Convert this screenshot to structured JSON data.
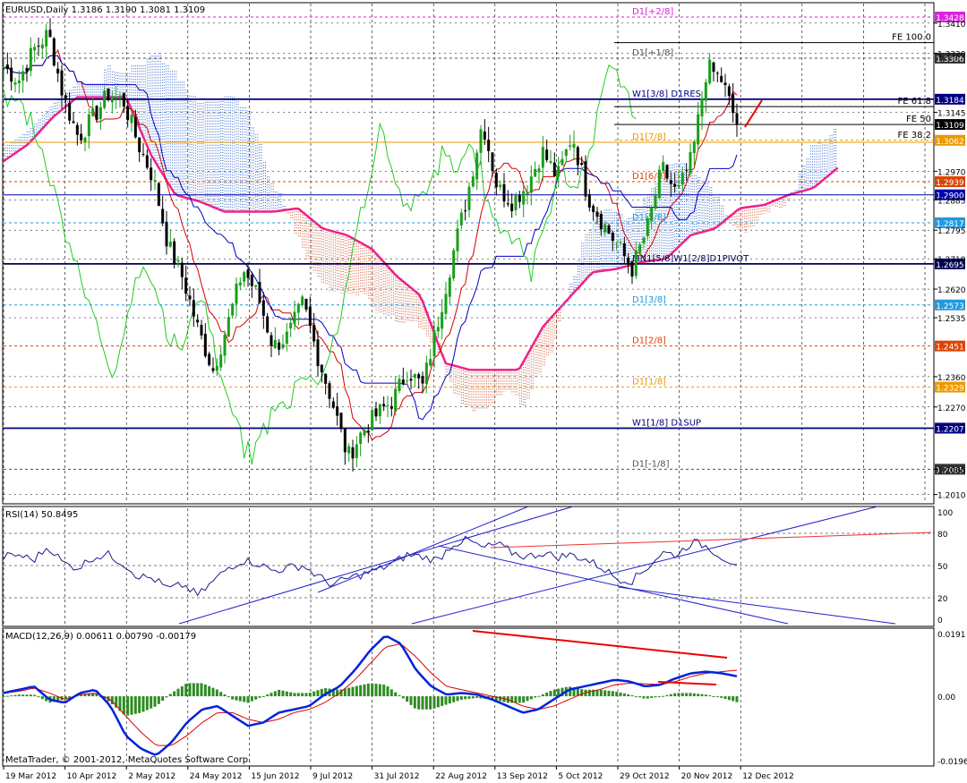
{
  "header": {
    "main_title": "EURUSD,Daily  1.3186 1.3190 1.3081 1.3109",
    "rsi_title": "RSI(14) 50.8495",
    "macd_title": "MACD(12,26,9) 0.00611 0.00790 -0.00179",
    "copyright": "MetaTrader, © 2001-2012, MetaQuotes Software Corp."
  },
  "colors": {
    "tenkan": "#d40000",
    "kijun": "#0000c0",
    "chikou": "#22cc22",
    "senkou_b": "#ee2288",
    "kumo_bull": "#3366cc",
    "kumo_bear": "#cc5533",
    "rsi": "#1a1a8c",
    "macd": "#0022dd",
    "signal": "#dd0000",
    "hist": "#2e8b22",
    "bull_candle": "#1a9e1a",
    "bear_candle": "#000000"
  },
  "chart_data": [
    {
      "type": "line",
      "title": "EURUSD,Daily  1.3186 1.3190 1.3081 1.3109",
      "x_tick_labels": [
        "19 Mar 2012",
        "10 Apr 2012",
        "2 May 2012",
        "24 May 2012",
        "15 Jun 2012",
        "9 Jul 2012",
        "31 Jul 2012",
        "22 Aug 2012",
        "13 Sep 2012",
        "5 Oct 2012",
        "29 Oct 2012",
        "20 Nov 2012",
        "12 Dec 2012"
      ],
      "y_ticks": [
        "1.3410",
        "1.3320",
        "1.3145",
        "1.2970",
        "1.2885",
        "1.2795",
        "1.2710",
        "1.2620",
        "1.2535",
        "1.2360",
        "1.2270",
        "1.2085",
        "1.2010"
      ],
      "ylim": [
        1.1985,
        1.3468
      ],
      "close_anchors": [
        1.328,
        1.324,
        1.333,
        1.338,
        1.319,
        1.307,
        1.313,
        1.32,
        1.318,
        1.305,
        1.295,
        1.275,
        1.265,
        1.25,
        1.238,
        1.252,
        1.268,
        1.26,
        1.245,
        1.248,
        1.258,
        1.242,
        1.228,
        1.212,
        1.22,
        1.225,
        1.229,
        1.238,
        1.233,
        1.252,
        1.272,
        1.29,
        1.312,
        1.292,
        1.288,
        1.293,
        1.303,
        1.295,
        1.308,
        1.29,
        1.282,
        1.275,
        1.268,
        1.28,
        1.298,
        1.29,
        1.301,
        1.328,
        1.324,
        1.3109
      ],
      "senkou_b_anchors": [
        1.3,
        1.305,
        1.313,
        1.319,
        1.319,
        1.319,
        1.302,
        1.29,
        1.288,
        1.285,
        1.285,
        1.285,
        1.286,
        1.28,
        1.278,
        1.274,
        1.266,
        1.26,
        1.24,
        1.238,
        1.238,
        1.238,
        1.251,
        1.259,
        1.267,
        1.268,
        1.27,
        1.271,
        1.278,
        1.28,
        1.286,
        1.287,
        1.29,
        1.292,
        1.298
      ],
      "levels": [
        {
          "label": "D1[+2/8]",
          "badge": "1.3428",
          "value": 1.3428,
          "color": "#dd22dd",
          "dash": "3,3",
          "badge_bg": "#dd22dd"
        },
        {
          "label": "FE 100.0",
          "badge": "",
          "value": 1.3352,
          "color": "#000000",
          "dash": "",
          "badge_bg": ""
        },
        {
          "label": "D1[+1/8]",
          "badge": "1.3306",
          "value": 1.3306,
          "color": "#555555",
          "dash": "3,3",
          "badge_bg": "#333333"
        },
        {
          "label": "W1[3/8] D1RES",
          "badge": "1.3184",
          "value": 1.3184,
          "color": "#000080",
          "dash": "",
          "badge_bg": "#000080"
        },
        {
          "label": "FE 61.8",
          "badge": "",
          "value": 1.3162,
          "color": "#000000",
          "dash": "",
          "badge_bg": ""
        },
        {
          "label": "FE 50",
          "badge": "1.3109",
          "value": 1.3109,
          "color": "#000000",
          "dash": "",
          "badge_bg": "#000000"
        },
        {
          "label": "FE 38.2",
          "badge": "1.3062",
          "value": 1.3062,
          "color": "#ee9900",
          "dash": "3,3",
          "badge_bg": "#ee9900"
        },
        {
          "label": "D1[7/8]",
          "badge": "",
          "value": 1.3056,
          "color": "#ee9900",
          "dash": "",
          "badge_bg": ""
        },
        {
          "label": "D1[6/8]",
          "badge": "1.2939",
          "value": 1.2939,
          "color": "#dd4400",
          "dash": "3,3",
          "badge_bg": "#dd4400"
        },
        {
          "label": "",
          "badge": "1.2900",
          "value": 1.29,
          "color": "#0000aa",
          "dash": "",
          "badge_bg": "#0000aa"
        },
        {
          "label": "D1[5/8]",
          "badge": "1.2817",
          "value": 1.2817,
          "color": "#2299dd",
          "dash": "3,3",
          "badge_bg": "#2299dd"
        },
        {
          "label": "MN1[5/8]W1[2/8]D1PIVOT",
          "badge": "1.2695",
          "value": 1.2695,
          "color": "#000055",
          "dash": "",
          "badge_bg": "#000055"
        },
        {
          "label": "D1[3/8]",
          "badge": "1.2573",
          "value": 1.2573,
          "color": "#2299dd",
          "dash": "3,3",
          "badge_bg": "#2299dd"
        },
        {
          "label": "D1[2/8]",
          "badge": "1.2451",
          "value": 1.2451,
          "color": "#dd4400",
          "dash": "3,3",
          "badge_bg": "#dd4400"
        },
        {
          "label": "D1[1/8]",
          "badge": "1.2329",
          "value": 1.2329,
          "color": "#ee9900",
          "dash": "3,3",
          "badge_bg": "#ee9900"
        },
        {
          "label": "W1[1/8] D1SUP",
          "badge": "1.2207",
          "value": 1.2207,
          "color": "#000080",
          "dash": "",
          "badge_bg": "#000080"
        },
        {
          "label": "D1[-1/8]",
          "badge": "1.2085",
          "value": 1.2085,
          "color": "#555555",
          "dash": "3,3",
          "badge_bg": "#333333"
        }
      ]
    },
    {
      "type": "line",
      "title": "RSI(14) 50.8495",
      "y_ticks": [
        "100",
        "80",
        "50",
        "20",
        "0"
      ],
      "ylim": [
        0,
        100
      ],
      "rsi_anchors": [
        58,
        60,
        55,
        68,
        52,
        48,
        58,
        60,
        52,
        40,
        38,
        28,
        32,
        22,
        35,
        48,
        55,
        52,
        45,
        48,
        50,
        40,
        32,
        38,
        42,
        46,
        52,
        60,
        58,
        55,
        70,
        74,
        66,
        70,
        62,
        58,
        62,
        58,
        60,
        55,
        48,
        38,
        36,
        48,
        62,
        60,
        72,
        68,
        58,
        51
      ]
    },
    {
      "type": "line",
      "title": "MACD(12,26,9) 0.00611 0.00790 -0.00179",
      "y_ticks": [
        "0.0191",
        "0.00",
        "-0.0196"
      ],
      "ylim": [
        -0.0196,
        0.0191
      ],
      "macd_anchors": [
        0.001,
        0.002,
        0.003,
        -0.001,
        -0.002,
        0.001,
        0.002,
        -0.003,
        -0.012,
        -0.016,
        -0.018,
        -0.014,
        -0.008,
        -0.004,
        -0.003,
        -0.006,
        -0.009,
        -0.008,
        -0.005,
        -0.004,
        -0.003,
        0.0005,
        0.003,
        0.008,
        0.014,
        0.0185,
        0.016,
        0.008,
        0.003,
        0.0005,
        0.001,
        0.0005,
        -0.001,
        -0.003,
        -0.005,
        -0.004,
        -0.001,
        0.002,
        0.003,
        0.004,
        0.005,
        0.0045,
        0.003,
        0.0035,
        0.0055,
        0.007,
        0.0075,
        0.007,
        0.0061
      ],
      "signal_anchors": [
        0.001,
        0.0015,
        0.0025,
        0.001,
        -0.001,
        0.0005,
        0.001,
        -0.001,
        -0.006,
        -0.011,
        -0.015,
        -0.015,
        -0.012,
        -0.008,
        -0.005,
        -0.005,
        -0.007,
        -0.008,
        -0.007,
        -0.005,
        -0.004,
        -0.002,
        0.001,
        0.005,
        0.01,
        0.015,
        0.016,
        0.012,
        0.007,
        0.003,
        0.002,
        0.001,
        0.0,
        -0.001,
        -0.003,
        -0.004,
        -0.003,
        -0.001,
        0.001,
        0.002,
        0.0035,
        0.004,
        0.0038,
        0.0036,
        0.0045,
        0.006,
        0.007,
        0.0075,
        0.0079
      ]
    }
  ]
}
